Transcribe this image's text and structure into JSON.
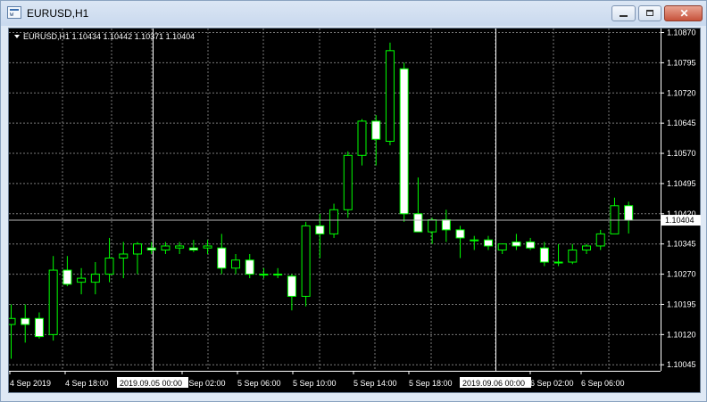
{
  "window": {
    "title": "EURUSD,H1",
    "controls": [
      "minimize",
      "maximize",
      "close"
    ],
    "close_glyph": "✕"
  },
  "chart": {
    "header": "EURUSD,H1  1.10434 1.10442 1.10371 1.10404",
    "colors": {
      "background": "#000000",
      "grid": "#7a7a7a",
      "up_body": "#000000",
      "down_body": "#ffffff",
      "wick": "#00ff00",
      "body_border": "#00ff00",
      "current_price_line": "#b9b9b9",
      "period_separator": "#ffffff"
    }
  },
  "chart_data": {
    "type": "candlestick",
    "symbol": "EURUSD",
    "timeframe": "H1",
    "ylim": [
      1.1003,
      1.1088
    ],
    "y_ticks": [
      "1.10870",
      "1.10795",
      "1.10720",
      "1.10645",
      "1.10570",
      "1.10495",
      "1.10420",
      "1.10345",
      "1.10270",
      "1.10195",
      "1.10120",
      "1.10045"
    ],
    "x_ticks": [
      "4 Sep 2019",
      "4 Sep 18:00",
      "5 Sep 02:00",
      "5 Sep 06:00",
      "5 Sep 10:00",
      "5 Sep 14:00",
      "5 Sep 18:00",
      "6 Sep 02:00",
      "6 Sep 06:00"
    ],
    "period_separator_labels": [
      "2019.09.05 00:00",
      "2019.09.06 00:00"
    ],
    "current_price": "1.10404",
    "series": [
      {
        "o": 1.10145,
        "h": 1.10195,
        "l": 1.1006,
        "c": 1.1016
      },
      {
        "o": 1.1016,
        "h": 1.10195,
        "l": 1.101,
        "c": 1.10145
      },
      {
        "o": 1.1016,
        "h": 1.10175,
        "l": 1.1011,
        "c": 1.10115
      },
      {
        "o": 1.1012,
        "h": 1.10315,
        "l": 1.10105,
        "c": 1.1028
      },
      {
        "o": 1.1028,
        "h": 1.10315,
        "l": 1.1024,
        "c": 1.10245
      },
      {
        "o": 1.1025,
        "h": 1.10285,
        "l": 1.1022,
        "c": 1.1026
      },
      {
        "o": 1.1025,
        "h": 1.103,
        "l": 1.1022,
        "c": 1.1027
      },
      {
        "o": 1.1027,
        "h": 1.1036,
        "l": 1.1025,
        "c": 1.1031
      },
      {
        "o": 1.1031,
        "h": 1.1035,
        "l": 1.1026,
        "c": 1.1032
      },
      {
        "o": 1.1032,
        "h": 1.1035,
        "l": 1.1027,
        "c": 1.10345
      },
      {
        "o": 1.10335,
        "h": 1.1035,
        "l": 1.1032,
        "c": 1.1033
      },
      {
        "o": 1.1033,
        "h": 1.1035,
        "l": 1.1032,
        "c": 1.1034
      },
      {
        "o": 1.10335,
        "h": 1.1035,
        "l": 1.1032,
        "c": 1.1034
      },
      {
        "o": 1.10335,
        "h": 1.10355,
        "l": 1.10325,
        "c": 1.1033
      },
      {
        "o": 1.10335,
        "h": 1.10355,
        "l": 1.1032,
        "c": 1.1034
      },
      {
        "o": 1.10335,
        "h": 1.1037,
        "l": 1.1027,
        "c": 1.10285
      },
      {
        "o": 1.10285,
        "h": 1.1032,
        "l": 1.1027,
        "c": 1.10305
      },
      {
        "o": 1.10305,
        "h": 1.1032,
        "l": 1.1026,
        "c": 1.1027
      },
      {
        "o": 1.1027,
        "h": 1.10285,
        "l": 1.1026,
        "c": 1.1027
      },
      {
        "o": 1.1027,
        "h": 1.10285,
        "l": 1.1026,
        "c": 1.1027
      },
      {
        "o": 1.10265,
        "h": 1.1027,
        "l": 1.1018,
        "c": 1.10215
      },
      {
        "o": 1.10215,
        "h": 1.104,
        "l": 1.1019,
        "c": 1.1039
      },
      {
        "o": 1.1039,
        "h": 1.1042,
        "l": 1.1031,
        "c": 1.1037
      },
      {
        "o": 1.1037,
        "h": 1.10445,
        "l": 1.1036,
        "c": 1.1043
      },
      {
        "o": 1.1043,
        "h": 1.10575,
        "l": 1.1041,
        "c": 1.10565
      },
      {
        "o": 1.10565,
        "h": 1.10655,
        "l": 1.1054,
        "c": 1.1065
      },
      {
        "o": 1.1065,
        "h": 1.10665,
        "l": 1.1054,
        "c": 1.10605
      },
      {
        "o": 1.106,
        "h": 1.10845,
        "l": 1.1059,
        "c": 1.10825
      },
      {
        "o": 1.1078,
        "h": 1.10795,
        "l": 1.104,
        "c": 1.1042
      },
      {
        "o": 1.1042,
        "h": 1.1051,
        "l": 1.10375,
        "c": 1.10375
      },
      {
        "o": 1.10375,
        "h": 1.1041,
        "l": 1.10345,
        "c": 1.10405
      },
      {
        "o": 1.10405,
        "h": 1.1043,
        "l": 1.1035,
        "c": 1.1038
      },
      {
        "o": 1.1038,
        "h": 1.1039,
        "l": 1.1031,
        "c": 1.1036
      },
      {
        "o": 1.10355,
        "h": 1.10365,
        "l": 1.1033,
        "c": 1.10355
      },
      {
        "o": 1.10355,
        "h": 1.10365,
        "l": 1.1033,
        "c": 1.1034
      },
      {
        "o": 1.1033,
        "h": 1.10345,
        "l": 1.1032,
        "c": 1.10345
      },
      {
        "o": 1.1035,
        "h": 1.1037,
        "l": 1.1033,
        "c": 1.1034
      },
      {
        "o": 1.1035,
        "h": 1.1036,
        "l": 1.1033,
        "c": 1.10335
      },
      {
        "o": 1.10335,
        "h": 1.1035,
        "l": 1.1029,
        "c": 1.103
      },
      {
        "o": 1.103,
        "h": 1.10345,
        "l": 1.1029,
        "c": 1.103
      },
      {
        "o": 1.103,
        "h": 1.10345,
        "l": 1.10295,
        "c": 1.1033
      },
      {
        "o": 1.1033,
        "h": 1.10345,
        "l": 1.1032,
        "c": 1.1034
      },
      {
        "o": 1.1034,
        "h": 1.1038,
        "l": 1.1033,
        "c": 1.1037
      },
      {
        "o": 1.1037,
        "h": 1.1046,
        "l": 1.1037,
        "c": 1.1044
      },
      {
        "o": 1.1044,
        "h": 1.1045,
        "l": 1.10371,
        "c": 1.10404
      }
    ]
  }
}
